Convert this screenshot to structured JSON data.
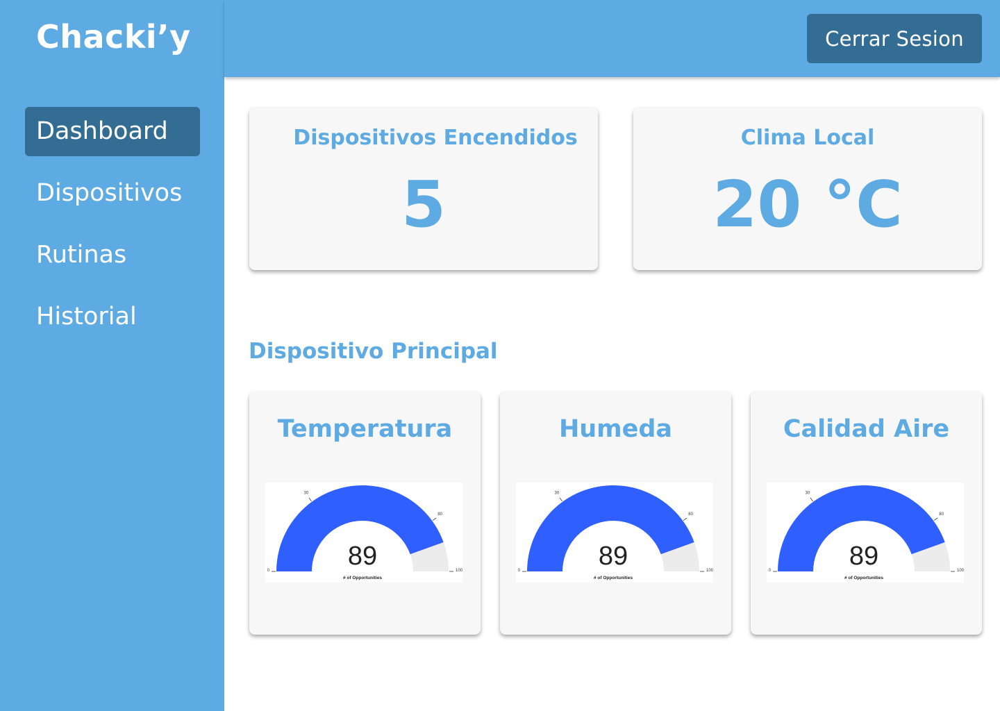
{
  "app": {
    "title": "Chacki’y"
  },
  "header": {
    "logout_label": "Cerrar Sesion"
  },
  "sidebar": {
    "items": [
      {
        "label": "Dashboard",
        "active": true
      },
      {
        "label": "Dispositivos",
        "active": false
      },
      {
        "label": "Rutinas",
        "active": false
      },
      {
        "label": "Historial",
        "active": false
      }
    ]
  },
  "stats": {
    "devices_on": {
      "title": "Dispositivos Encendidos",
      "value": "5"
    },
    "weather": {
      "title": "Clima Local",
      "value": "20 °C"
    }
  },
  "main_device": {
    "title": "Dispositivo Principal",
    "gauges": [
      {
        "title": "Temperatura",
        "value": "89",
        "level": 89,
        "caption": "# of Opportunities",
        "ticks": [
          "0",
          "30",
          "80",
          "100"
        ]
      },
      {
        "title": "Humeda",
        "value": "89",
        "level": 89,
        "caption": "# of Opportunities",
        "ticks": [
          "0",
          "30",
          "80",
          "100"
        ]
      },
      {
        "title": "Calidad Aire",
        "value": "89",
        "level": 89,
        "caption": "# of Opportunities",
        "ticks": [
          "0",
          "30",
          "80",
          "100"
        ]
      }
    ]
  },
  "colors": {
    "primary": "#5eaae2",
    "dark": "#336d93",
    "card_bg": "#f7f7f7",
    "gauge_fill": "#2f5fff",
    "gauge_track": "#ececec"
  }
}
